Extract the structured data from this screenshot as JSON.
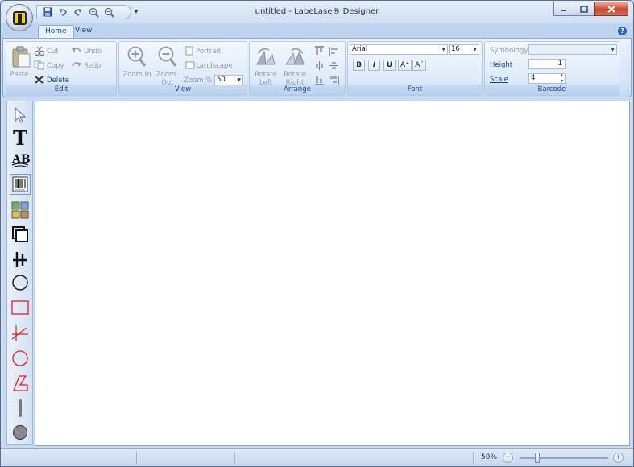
{
  "window": {
    "title": "untitled - LabeLase® Designer"
  },
  "qat": {
    "dropdown_glyph": "▾"
  },
  "tabs": [
    {
      "label": "Home",
      "active": true
    },
    {
      "label": "View",
      "active": false
    }
  ],
  "ribbon": {
    "edit": {
      "label": "Edit",
      "paste": "Paste",
      "cut": "Cut",
      "copy": "Copy",
      "delete": "Delete",
      "undo": "Undo",
      "redo": "Redo"
    },
    "view": {
      "label": "View",
      "zoom_in": "Zoom In",
      "zoom_out_1": "Zoom",
      "zoom_out_2": "Out",
      "portrait": "Portrait",
      "landscape": "Landscape",
      "zoom_pct_label": "Zoom %",
      "zoom_pct_value": "50"
    },
    "arrange": {
      "label": "Arrange",
      "rotate_left_1": "Rotate",
      "rotate_left_2": "Left",
      "rotate_right_1": "Rotate",
      "rotate_right_2": "Right"
    },
    "font": {
      "label": "Font",
      "family": "Arial",
      "size": "16",
      "bold": "B",
      "italic": "I",
      "underline": "U",
      "grow": "A⁺",
      "shrink": "Aˇ"
    },
    "barcode": {
      "label": "Barcode",
      "symbology_label": "Symbology",
      "symbology_value": "",
      "height_label": "Height",
      "height_value": "1",
      "scale_label": "Scale",
      "scale_value": "4"
    }
  },
  "statusbar": {
    "zoom_percent": "50%",
    "zoom_level": 0.2,
    "zoom_minus": "−",
    "zoom_plus": "+"
  },
  "colors": {
    "accent": "#15428b",
    "red_tools": "#e02020",
    "disabled_text": "#8a9ab3"
  }
}
